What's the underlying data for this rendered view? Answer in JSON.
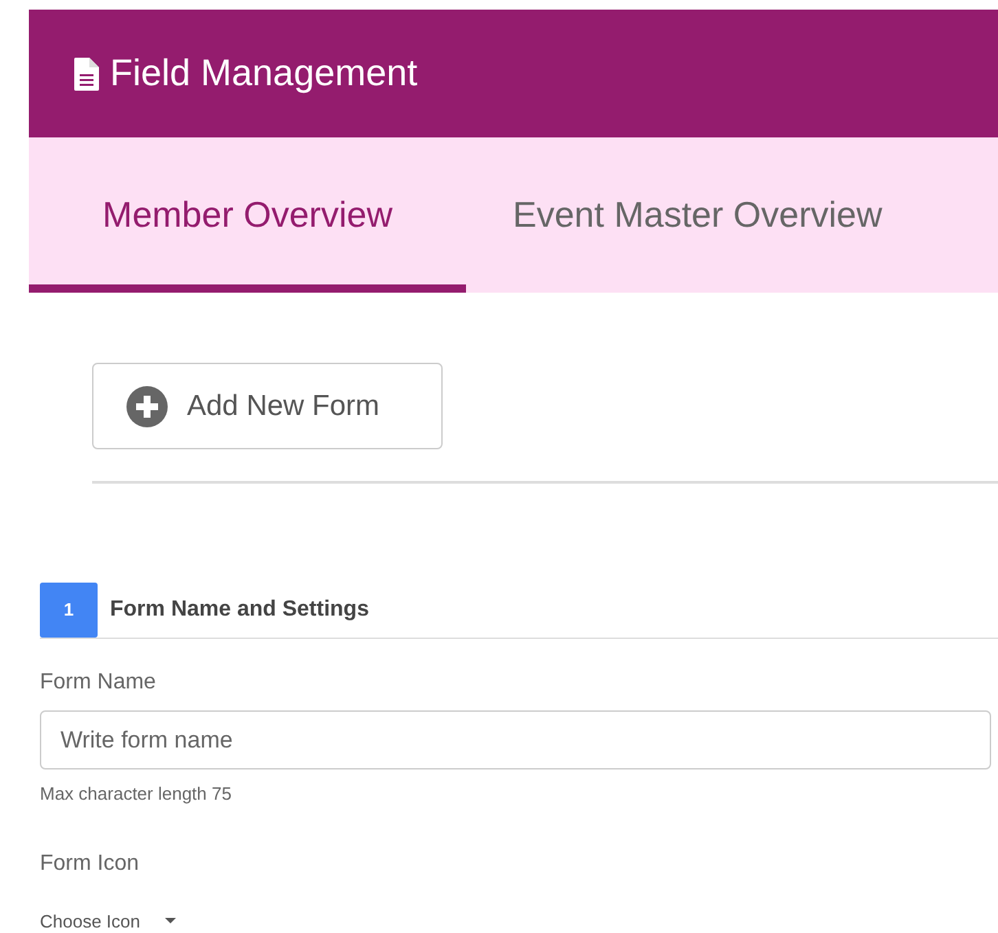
{
  "header": {
    "title": "Field Management"
  },
  "tabs": [
    {
      "label": "Member Overview",
      "selected": true
    },
    {
      "label": "Event Master Overview",
      "selected": false
    }
  ],
  "add_button": {
    "label": "Add New Form"
  },
  "section": {
    "number": "1",
    "title": "Form Name and Settings"
  },
  "form_name": {
    "label": "Form Name",
    "placeholder": "Write form name",
    "help": "Max character length 75"
  },
  "form_icon": {
    "label": "Form Icon",
    "dropdown": "Choose Icon"
  }
}
